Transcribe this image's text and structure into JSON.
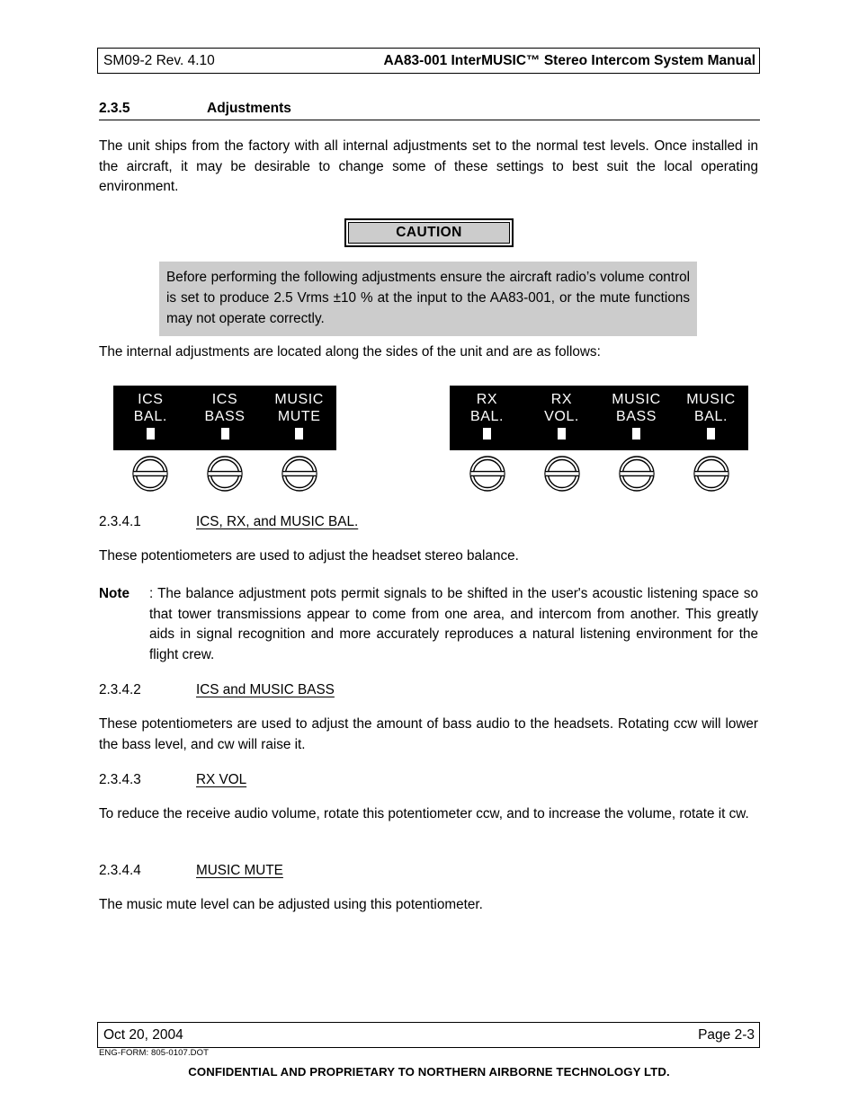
{
  "header": {
    "left": "SM09-2 Rev. 4.10",
    "right": "AA83-001 InterMUSIC™ Stereo Intercom System Manual"
  },
  "section": {
    "number": "2.3.5",
    "title": "Adjustments"
  },
  "intro_paragraph": "The unit ships from the factory with all internal adjustments set to the normal test levels.  Once installed in the aircraft, it may be desirable to change some of these settings to best suit the local operating environment.",
  "caution": {
    "label": "CAUTION",
    "body": "Before performing the following adjustments ensure the aircraft radio’s volume control is set to produce 2.5 Vrms ±10 % at the input to the AA83-001, or the mute functions may not operate correctly.",
    "fill_color": "#cccccc"
  },
  "lead_in_paragraph": "The internal adjustments are located along the sides of the unit and are as follows:",
  "diagram": {
    "panel_background": "#000000",
    "panel_text_color": "#ffffff",
    "left_panel": {
      "controls": [
        {
          "line1": "ICS",
          "line2": "BAL."
        },
        {
          "line1": "ICS",
          "line2": "BASS"
        },
        {
          "line1": "MUSIC",
          "line2": "MUTE"
        }
      ]
    },
    "right_panel": {
      "controls": [
        {
          "line1": "RX",
          "line2": "BAL."
        },
        {
          "line1": "RX",
          "line2": "VOL."
        },
        {
          "line1": "MUSIC",
          "line2": "BASS"
        },
        {
          "line1": "MUSIC",
          "line2": "BAL."
        }
      ]
    }
  },
  "subsections": [
    {
      "number": "2.3.4.1",
      "title": "ICS, RX, and MUSIC BAL.",
      "body": "These potentiometers are used to adjust the headset stereo balance.",
      "note_label": "Note",
      "note_body": ": The balance adjustment pots permit signals to be shifted in the user's acoustic listening space so that tower transmissions appear to come from one area, and intercom from another.   This greatly aids in signal recognition and more accurately reproduces a natural listening environment for the flight crew."
    },
    {
      "number": "2.3.4.2",
      "title": "ICS and MUSIC BASS",
      "body": "These potentiometers are used to adjust the amount of bass audio to the headsets.  Rotating ccw will lower the bass level, and cw will raise it."
    },
    {
      "number": "2.3.4.3",
      "title": "RX VOL",
      "body": "To reduce the receive audio volume, rotate this potentiometer ccw, and to increase the volume, rotate it cw."
    },
    {
      "number": "2.3.4.4",
      "title": "MUSIC MUTE",
      "body": "The music mute level can be adjusted using this potentiometer."
    }
  ],
  "footer": {
    "date": "Oct 20, 2004",
    "page": "Page 2-3",
    "form": "ENG-FORM: 805-0107.DOT",
    "confidential": "CONFIDENTIAL AND PROPRIETARY TO NORTHERN AIRBORNE TECHNOLOGY LTD."
  }
}
